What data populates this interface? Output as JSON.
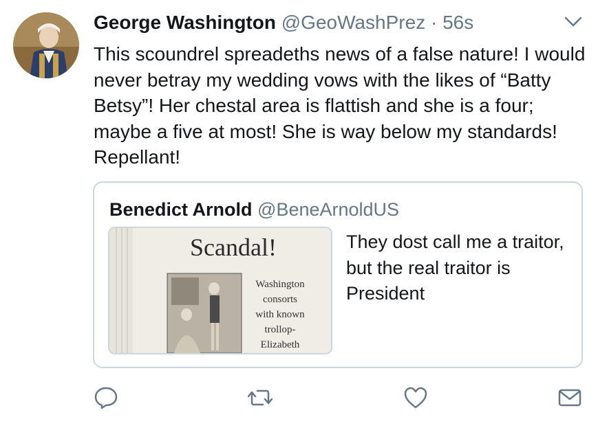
{
  "tweet": {
    "author_name": "George Washington",
    "handle": "@GeoWashPrez",
    "separator": "·",
    "time": "56s",
    "text": "This scoundrel spreadeths news of a false nature! I would never betray my wedding vows with the likes of “Batty Betsy”! Her chestal area is flattish and she is a four; maybe a five at most! She is way below my standards! Repellant!"
  },
  "quote": {
    "author_name": "Benedict Arnold",
    "handle": "@BeneArnoldUS",
    "text": "They dost call me a traitor, but the real traitor is President",
    "media": {
      "headline": "Scandal!",
      "caption_lines": [
        "Washington",
        "consorts",
        "with known",
        "trollop-",
        "Elizabeth"
      ]
    }
  },
  "actions": {
    "icons": [
      "reply-icon",
      "retweet-icon",
      "like-icon",
      "message-icon"
    ]
  },
  "colors": {
    "text": "#14171a",
    "secondary": "#657786",
    "border": "#ccd6dd"
  }
}
